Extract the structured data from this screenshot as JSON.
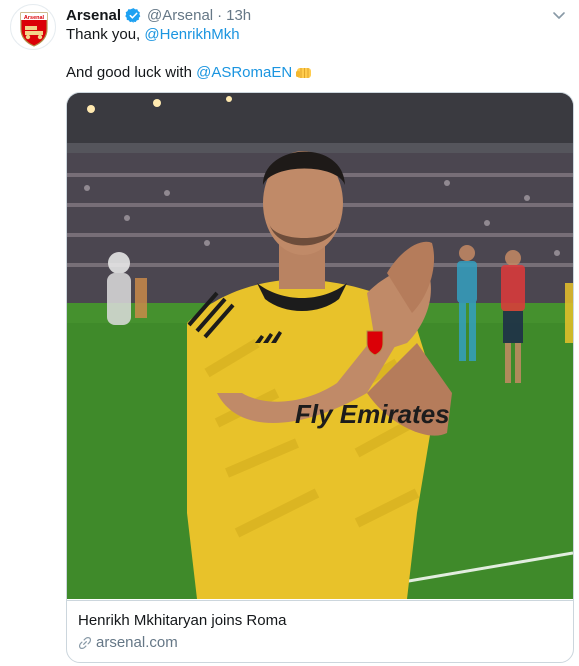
{
  "tweet": {
    "account_name": "Arsenal",
    "handle": "@Arsenal",
    "separator": "·",
    "time": "13h",
    "line1_prefix": "Thank you, ",
    "line1_mention": "@HenrikhMkh",
    "line2_prefix": "And good luck with ",
    "line2_mention": "@ASRomaEN",
    "avatar_logo_text": "Arsenal"
  },
  "card": {
    "title": "Henrikh Mkhitaryan joins Roma",
    "domain": "arsenal.com",
    "shirt_text": "Fly Emirates"
  },
  "icons": {
    "verified": "verified-badge-icon",
    "chevron": "chevron-down-icon",
    "emoji": "oncoming-fist-icon",
    "link": "link-icon"
  },
  "colors": {
    "link": "#1b95e0",
    "secondary_text": "#657786",
    "verified_blue": "#1da1f2",
    "arsenal_red": "#db0007",
    "kit_yellow": "#e8c22a",
    "pitch_green": "#3f8a2a"
  }
}
